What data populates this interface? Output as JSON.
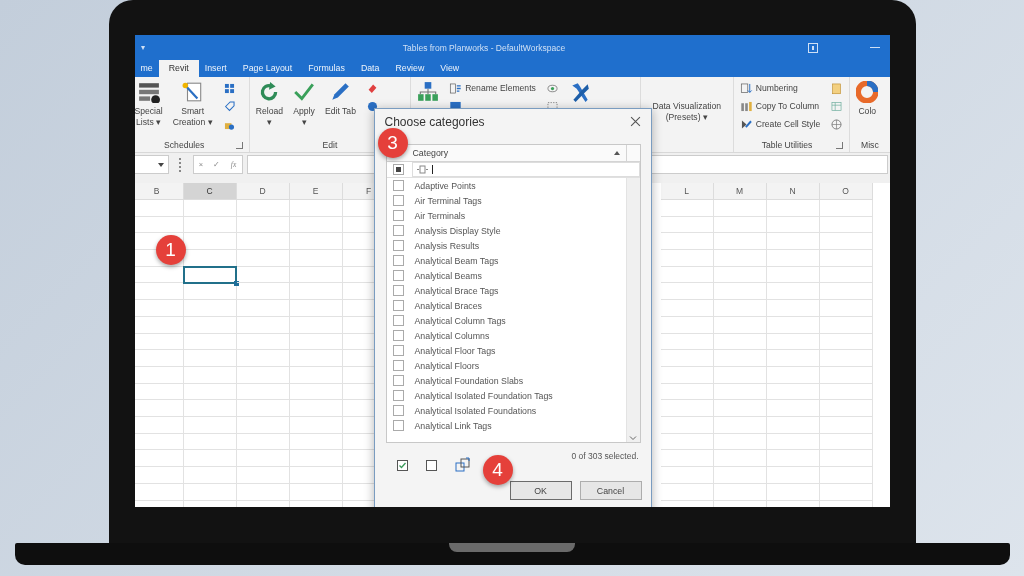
{
  "window": {
    "title": "Tables from Planworks - DefaultWorkspace",
    "quick_access": "▾"
  },
  "tabs": [
    {
      "label": "me",
      "selected": false
    },
    {
      "label": "Revit",
      "selected": true
    },
    {
      "label": "Insert",
      "selected": false
    },
    {
      "label": "Page Layout",
      "selected": false
    },
    {
      "label": "Formulas",
      "selected": false
    },
    {
      "label": "Data",
      "selected": false
    },
    {
      "label": "Review",
      "selected": false
    },
    {
      "label": "View",
      "selected": false
    }
  ],
  "ribbon": {
    "groups": [
      {
        "kind": "schedules",
        "label": "Schedules",
        "launcher": true,
        "items": [
          {
            "kind": "large",
            "lines": [
              "Special",
              "Lists ▾"
            ]
          },
          {
            "kind": "large",
            "lines": [
              "Smart",
              "Creation ▾"
            ]
          },
          {
            "kind": "icons"
          }
        ]
      },
      {
        "kind": "edit",
        "label": "Edit",
        "launcher": false,
        "items": [
          {
            "kind": "large",
            "lines": [
              "Reload",
              "▾"
            ]
          },
          {
            "kind": "large",
            "lines": [
              "Apply",
              "▾"
            ]
          },
          {
            "kind": "large",
            "lines": [
              "Edit Tab"
            ]
          },
          {
            "kind": "icons"
          }
        ]
      },
      {
        "kind": "compare",
        "launcher": false,
        "items": [
          {
            "kind": "large"
          },
          {
            "kind": "stack",
            "rows": [
              {
                "label": "Rename Elements"
              }
            ]
          },
          {
            "kind": "icons"
          },
          {
            "kind": "large"
          }
        ]
      },
      {
        "kind": "visual",
        "launcher": false,
        "items": [
          {
            "kind": "large",
            "lines": [
              "Data Visualization",
              "(Presets) ▾"
            ]
          }
        ]
      },
      {
        "kind": "utilities",
        "label": "Table Utilities",
        "launcher": true,
        "items": [
          {
            "kind": "stack",
            "rows": [
              {
                "label": "Numbering"
              },
              {
                "label": "Copy To Column"
              },
              {
                "label": "Create Cell Style"
              }
            ]
          },
          {
            "kind": "icons"
          }
        ]
      },
      {
        "kind": "misc",
        "label": "Misc",
        "launcher": false,
        "items": [
          {
            "kind": "large",
            "lines": [
              "Colo"
            ]
          }
        ]
      }
    ]
  },
  "formula_bar": {
    "buttons": [
      "×",
      "✓",
      "fx"
    ]
  },
  "sheet": {
    "columns_left": [
      {
        "label": "B",
        "selected": false
      },
      {
        "label": "C",
        "selected": true
      },
      {
        "label": "D",
        "selected": false
      },
      {
        "label": "E",
        "selected": false
      },
      {
        "label": "F",
        "selected": false
      }
    ],
    "columns_right": [
      {
        "label": "L",
        "selected": false
      },
      {
        "label": "M",
        "selected": false
      },
      {
        "label": "N",
        "selected": false
      },
      {
        "label": "O",
        "selected": false
      }
    ]
  },
  "dialog": {
    "title": "Choose categories",
    "column": "Category",
    "filter_checked": true,
    "items": [
      {
        "label": "Adaptive Points",
        "checked": false
      },
      {
        "label": "Air Terminal Tags",
        "checked": false
      },
      {
        "label": "Air Terminals",
        "checked": false
      },
      {
        "label": "Analysis Display Style",
        "checked": false
      },
      {
        "label": "Analysis Results",
        "checked": false
      },
      {
        "label": "Analytical Beam Tags",
        "checked": false
      },
      {
        "label": "Analytical Beams",
        "checked": false
      },
      {
        "label": "Analytical Brace Tags",
        "checked": false
      },
      {
        "label": "Analytical Braces",
        "checked": false
      },
      {
        "label": "Analytical Column Tags",
        "checked": false
      },
      {
        "label": "Analytical Columns",
        "checked": false
      },
      {
        "label": "Analytical Floor Tags",
        "checked": false
      },
      {
        "label": "Analytical Floors",
        "checked": false
      },
      {
        "label": "Analytical Foundation Slabs",
        "checked": false
      },
      {
        "label": "Analytical Isolated Foundation Tags",
        "checked": false
      },
      {
        "label": "Analytical Isolated Foundations",
        "checked": false
      },
      {
        "label": "Analytical Link Tags",
        "checked": false
      }
    ],
    "status": "0 of 303 selected.",
    "buttons": [
      "OK",
      "Cancel"
    ]
  },
  "badges": [
    {
      "kind": "sheet",
      "text": "1"
    },
    {
      "kind": "list",
      "text": "3"
    },
    {
      "kind": "buttons",
      "text": "4"
    }
  ]
}
